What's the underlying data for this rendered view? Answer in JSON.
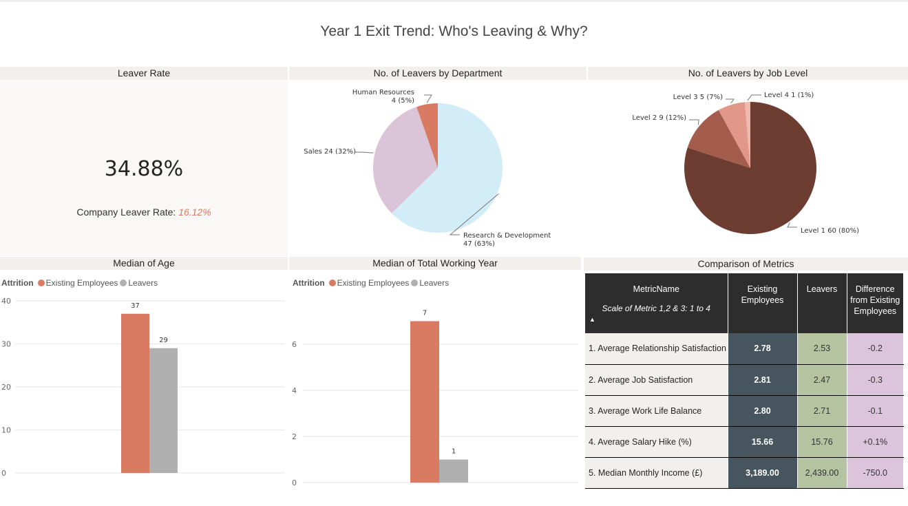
{
  "page": {
    "title": "Year 1 Exit Trend: Who's Leaving & Why?"
  },
  "kpi": {
    "header": "Leaver Rate",
    "value": "34.88%",
    "company_label": "Company Leaver Rate:",
    "company_value": "16.12%"
  },
  "legend": {
    "title": "Attrition",
    "existing": "Existing Employees",
    "leavers": "Leavers"
  },
  "colors": {
    "existing": "#d97b62",
    "leavers": "#b0b0b0",
    "dept_hr": "#d97b62",
    "dept_rd": "#d2edf7",
    "dept_sales": "#dbc4d8",
    "level1": "#6e3d31",
    "level2": "#a45d4c",
    "level3": "#e1978a",
    "level4": "#f0b9ab",
    "table_existing": "#47555e",
    "table_leavers": "#b5c3a1",
    "table_diff": "#dcc5dc"
  },
  "chart_data": [
    {
      "type": "pie",
      "title": "No. of Leavers by Department",
      "slices": [
        {
          "label": "Research & Development",
          "value": 47,
          "percent": "63%"
        },
        {
          "label": "Sales",
          "value": 24,
          "percent": "32%"
        },
        {
          "label": "Human Resources",
          "value": 4,
          "percent": "5%"
        }
      ]
    },
    {
      "type": "pie",
      "title": "No. of Leavers by Job Level",
      "slices": [
        {
          "label": "Level 1",
          "value": 60,
          "percent": "80%"
        },
        {
          "label": "Level 2",
          "value": 9,
          "percent": "12%"
        },
        {
          "label": "Level 3",
          "value": 5,
          "percent": "7%"
        },
        {
          "label": "Level 4",
          "value": 1,
          "percent": "1%"
        }
      ]
    },
    {
      "type": "bar",
      "title": "Median of Age",
      "series": [
        {
          "name": "Existing Employees",
          "value": 37
        },
        {
          "name": "Leavers",
          "value": 29
        }
      ],
      "ylim": [
        0,
        40
      ],
      "yticks": [
        0,
        10,
        20,
        30,
        40
      ]
    },
    {
      "type": "bar",
      "title": "Median of Total Working Year",
      "series": [
        {
          "name": "Existing Employees",
          "value": 7
        },
        {
          "name": "Leavers",
          "value": 1
        }
      ],
      "ylim": [
        0,
        8
      ],
      "yticks": [
        0,
        2,
        4,
        6
      ]
    },
    {
      "type": "table",
      "title": "Comparison of Metrics",
      "columns": [
        "MetricName",
        "Existing Employees",
        "Leavers",
        "Difference from Existing Employees"
      ],
      "scale_note": "Scale of Metric 1,2 & 3: 1 to 4",
      "rows": [
        [
          "1. Average Relationship Satisfaction",
          "2.78",
          "2.53",
          "-0.2"
        ],
        [
          "2. Average Job Satisfaction",
          "2.81",
          "2.47",
          "-0.3"
        ],
        [
          "3. Average Work Life Balance",
          "2.80",
          "2.71",
          "-0.1"
        ],
        [
          "4. Average Salary Hike (%)",
          "15.66",
          "15.76",
          "+0.1%"
        ],
        [
          "5. Median Monthly Income (£)",
          "3,189.00",
          "2,439.00",
          "-750.0"
        ]
      ]
    }
  ]
}
